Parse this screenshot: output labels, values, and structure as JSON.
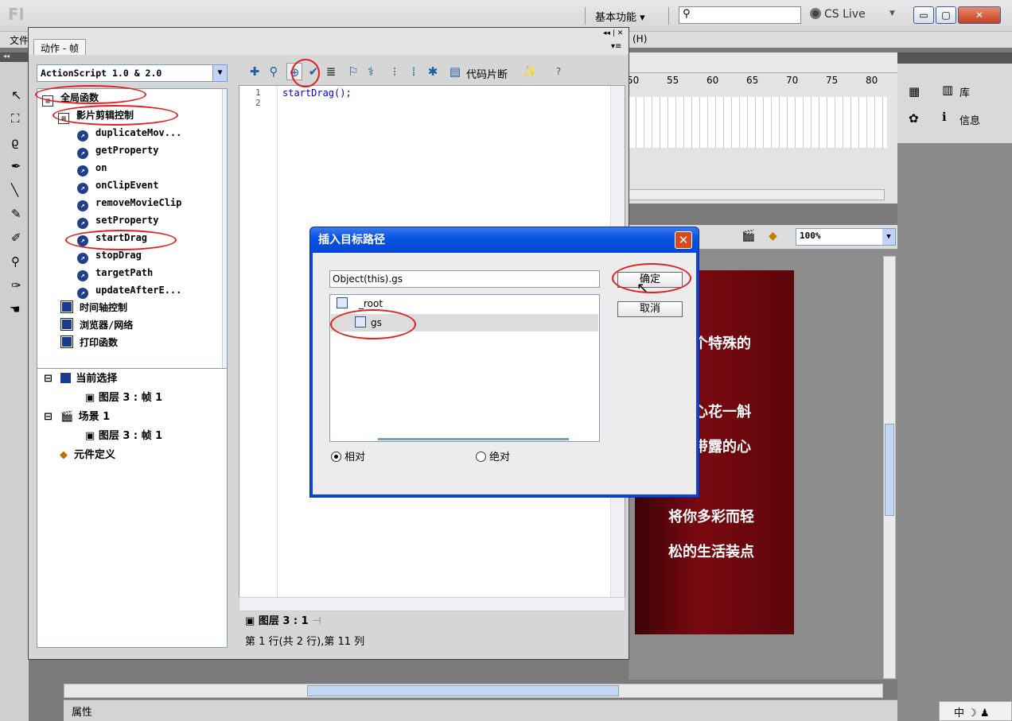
{
  "app": {
    "logo": "Fl",
    "workspace": "基本功能 ▾",
    "cslive": "CS Live",
    "menu_first": "文件",
    "menu_help": "(H)"
  },
  "actions": {
    "tab": "动作 - 帧",
    "language": "ActionScript 1.0 & 2.0",
    "tree": [
      {
        "label": "全局函数",
        "kind": "book-open"
      },
      {
        "label": "影片剪辑控制",
        "kind": "book-open"
      },
      {
        "label": "duplicateMov...",
        "kind": "fn"
      },
      {
        "label": "getProperty",
        "kind": "fn"
      },
      {
        "label": "on",
        "kind": "fn"
      },
      {
        "label": "onClipEvent",
        "kind": "fn"
      },
      {
        "label": "removeMovieClip",
        "kind": "fn"
      },
      {
        "label": "setProperty",
        "kind": "fn"
      },
      {
        "label": "startDrag",
        "kind": "fn"
      },
      {
        "label": "stopDrag",
        "kind": "fn"
      },
      {
        "label": "targetPath",
        "kind": "fn"
      },
      {
        "label": "updateAfterE...",
        "kind": "fn"
      },
      {
        "label": "时间轴控制",
        "kind": "book"
      },
      {
        "label": "浏览器/网络",
        "kind": "book"
      },
      {
        "label": "打印函数",
        "kind": "book"
      }
    ],
    "outline": {
      "current_selection": "当前选择",
      "layer_frame_1": "图层 3 : 帧 1",
      "scene": "场景 1",
      "layer_frame_2": "图层 3 : 帧 1",
      "symbol_def": "元件定义"
    },
    "code_snippets": "代码片断",
    "line_numbers": [
      "1",
      "2"
    ],
    "code_line": "startDrag();",
    "layer_tab": "图层 3 : 1",
    "status": "第 1 行(共 2 行),第 11 列"
  },
  "timeline": {
    "ticks": [
      "50",
      "55",
      "60",
      "65",
      "70",
      "75",
      "80"
    ]
  },
  "right_panel": {
    "library": "库",
    "info": "信息"
  },
  "zoom": "100%",
  "artboard_lines": [
    "这个特殊的",
    "心花一斛",
    "带露的心",
    "将你多彩而轻",
    "松的生活装点"
  ],
  "dialog": {
    "title": "插入目标路径",
    "path_value": "Object(this).gs",
    "tree_root": "_root",
    "tree_child": "gs",
    "ok": "确定",
    "cancel": "取消",
    "relative": "相对",
    "absolute": "绝对"
  },
  "properties_label": "属性",
  "ime": "中"
}
